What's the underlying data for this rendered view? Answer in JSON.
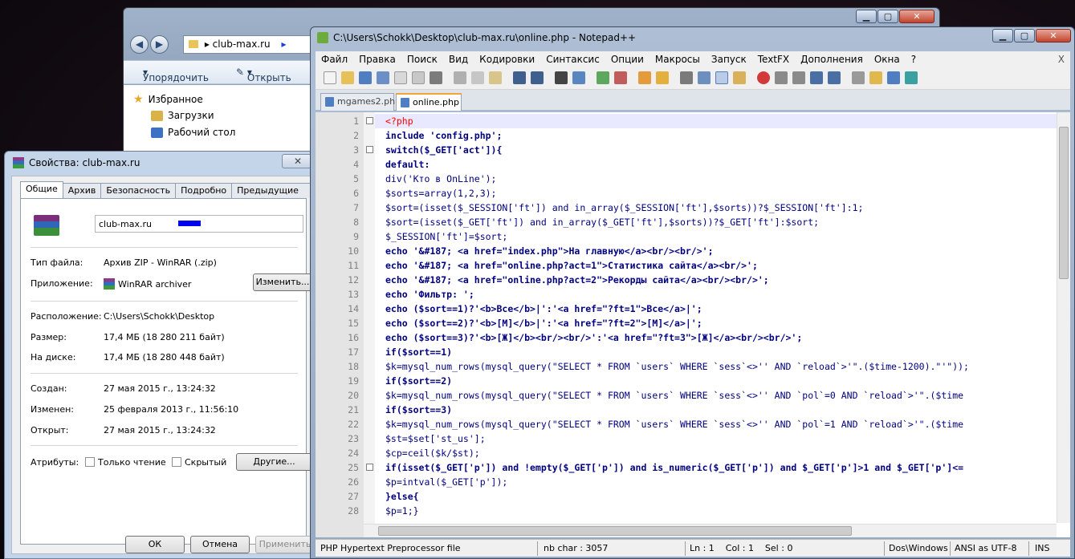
{
  "explorer": {
    "address": "club-max.ru",
    "organize_label": "Упорядочить",
    "open_label": "Открыть",
    "favorites": "Избранное",
    "downloads": "Загрузки",
    "desktop": "Рабочий стол"
  },
  "properties": {
    "title": "Свойства: club-max.ru",
    "close": "✕",
    "tabs": [
      "Общие",
      "Архив",
      "Безопасность",
      "Подробно",
      "Предыдущие версии"
    ],
    "file_name": "club-max.ru",
    "type_label": "Тип файла:",
    "type_value": "Архив ZIP - WinRAR (.zip)",
    "app_label": "Приложение:",
    "app_value": "WinRAR archiver",
    "change_button": "Изменить...",
    "location_label": "Расположение:",
    "location_value": "C:\\Users\\Schokk\\Desktop",
    "size_label": "Размер:",
    "size_value": "17,4 МБ (18 280 211 байт)",
    "disk_label": "На диске:",
    "disk_value": "17,4 МБ (18 280 448 байт)",
    "created_label": "Создан:",
    "created_value": "27 мая 2015 г., 13:24:32",
    "modified_label": "Изменен:",
    "modified_value": "25 февраля 2013 г., 11:56:10",
    "opened_label": "Открыт:",
    "opened_value": "27 мая 2015 г., 13:24:32",
    "attributes_label": "Атрибуты:",
    "readonly_label": "Только чтение",
    "hidden_label": "Скрытый",
    "other_button": "Другие...",
    "ok_button": "ОК",
    "cancel_button": "Отмена",
    "apply_button": "Применить"
  },
  "notepad": {
    "title": "C:\\Users\\Schokk\\Desktop\\club-max.ru\\online.php - Notepad++",
    "menu": [
      "Файл",
      "Правка",
      "Поиск",
      "Вид",
      "Кодировки",
      "Синтаксис",
      "Опции",
      "Макросы",
      "Запуск",
      "TextFX",
      "Дополнения",
      "Окна",
      "?"
    ],
    "menu_close": "X",
    "tabs": [
      "mgames2.php",
      "online.php"
    ],
    "line_numbers": [
      "1",
      "2",
      "3",
      "4",
      "5",
      "6",
      "7",
      "8",
      "9",
      "10",
      "11",
      "12",
      "13",
      "14",
      "15",
      "16",
      "17",
      "18",
      "19",
      "20",
      "21",
      "22",
      "23",
      "24",
      "25",
      "26",
      "27",
      "28"
    ],
    "code_lines": [
      "<?php",
      "include 'config.php';",
      "switch($_GET['act']){",
      "default:",
      "div('Кто в OnLine');",
      "$sorts=array(1,2,3);",
      "$sort=(isset($_SESSION['ft']) and in_array($_SESSION['ft'],$sorts))?$_SESSION['ft']:1;",
      "$sort=(isset($_GET['ft']) and in_array($_GET['ft'],$sorts))?$_GET['ft']:$sort;",
      "$_SESSION['ft']=$sort;",
      "echo '&#187; <a href=\"index.php\">На главную</a><br/><br/>';",
      "echo '&#187; <a href=\"online.php?act=1\">Статистика сайта</a><br/>';",
      "echo '&#187; <a href=\"online.php?act=2\">Рекорды сайта</a><br/><br/>';",
      "echo 'Фильтр: ';",
      "echo ($sort==1)?'<b>Все</b>|':'<a href=\"?ft=1\">Все</a>|';",
      "echo ($sort==2)?'<b>[M]</b>|':'<a href=\"?ft=2\">[M]</a>|';",
      "echo ($sort==3)?'<b>[Ж]</b><br/><br/>':'<a href=\"?ft=3\">[Ж]</a><br/><br/>';",
      "if($sort==1)",
      "$k=mysql_num_rows(mysql_query(\"SELECT * FROM `users` WHERE `sess`<>'' AND `reload`>'\".($time-1200).\"'\"));",
      "if($sort==2)",
      "$k=mysql_num_rows(mysql_query(\"SELECT * FROM `users` WHERE `sess`<>'' AND `pol`=0 AND `reload`>'\".($time",
      "if($sort==3)",
      "$k=mysql_num_rows(mysql_query(\"SELECT * FROM `users` WHERE `sess`<>'' AND `pol`=1 AND `reload`>'\".($time",
      "$st=$set['st_us'];",
      "$cp=ceil($k/$st);",
      "if(isset($_GET['p']) and !empty($_GET['p']) and is_numeric($_GET['p']) and $_GET['p']>1 and $_GET['p']<=",
      "$p=intval($_GET['p']);",
      "}else{",
      "$p=1;}"
    ],
    "status": {
      "file_type": "PHP Hypertext Preprocessor file",
      "chars": "nb char : 3057",
      "pos": "Ln : 1    Col : 1    Sel : 0",
      "eol": "Dos\\Windows",
      "encoding": "ANSI as UTF-8",
      "mode": "INS"
    }
  }
}
